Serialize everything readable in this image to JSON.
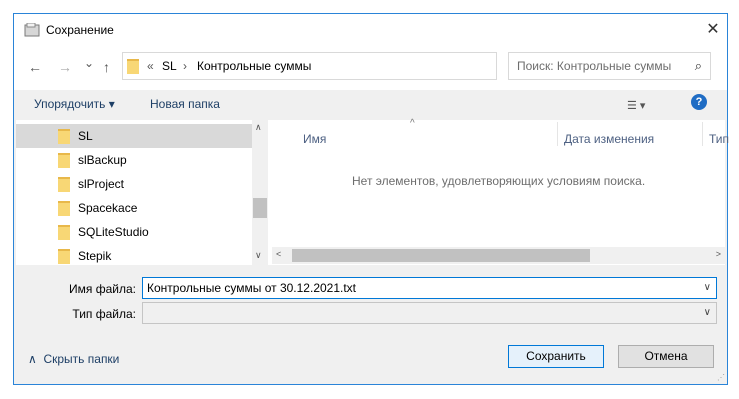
{
  "window": {
    "title": "Сохранение",
    "close_glyph": "✕"
  },
  "nav": {
    "back_glyph": "←",
    "forward_glyph": "→",
    "recent_glyph": "⌄",
    "up_glyph": "↑",
    "breadcrumb": {
      "chevrons": "«",
      "segments": [
        "SL",
        "Контрольные суммы"
      ],
      "separator": "›"
    },
    "refresh_glyph": "↻",
    "dropdown_glyph": "∨",
    "search_placeholder": "Поиск: Контрольные суммы",
    "search_glyph": "⌕"
  },
  "toolbar": {
    "organize_label": "Упорядочить ▾",
    "new_folder_label": "Новая папка",
    "view_glyph": "☰ ▾",
    "help_glyph": "?"
  },
  "tree": {
    "items": [
      {
        "label": "SL",
        "selected": true
      },
      {
        "label": "slBackup"
      },
      {
        "label": "slProject"
      },
      {
        "label": "Spacekace"
      },
      {
        "label": "SQLiteStudio"
      },
      {
        "label": "Stepik"
      }
    ],
    "scroll_up_glyph": "∧",
    "scroll_down_glyph": "∨"
  },
  "list": {
    "columns": [
      "Имя",
      "Дата изменения",
      "Тип"
    ],
    "sort_glyph": "^",
    "empty_message": "Нет элементов, удовлетворяющих условиям поиска.",
    "scroll_left_glyph": "<",
    "scroll_right_glyph": ">"
  },
  "form": {
    "filename_label": "Имя файла:",
    "filename_value": "Контрольные суммы от 30.12.2021.txt",
    "filetype_label": "Тип файла:",
    "filetype_value": "",
    "dropdown_glyph": "∨"
  },
  "footer": {
    "hide_folders_label": "Скрыть папки",
    "hide_glyph": "∧",
    "save_label": "Сохранить",
    "cancel_label": "Отмена"
  },
  "colors": {
    "accent": "#0078d7",
    "frame_border": "#2a84d8",
    "selection": "#d9d9d9"
  }
}
